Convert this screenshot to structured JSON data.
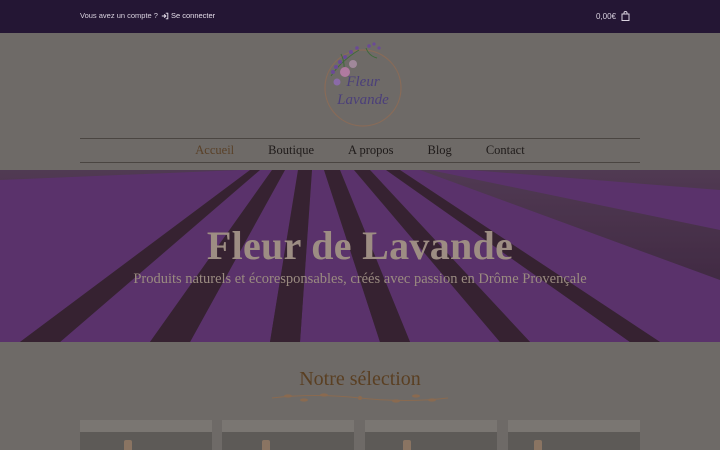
{
  "topbar": {
    "account_prompt": "Vous avez un compte ?",
    "login_label": "Se connecter",
    "cart_total": "0,00€"
  },
  "logo": {
    "line1": "Fleur",
    "line2": "Lavande"
  },
  "nav": {
    "items": [
      {
        "label": "Accueil",
        "active": true
      },
      {
        "label": "Boutique",
        "active": false
      },
      {
        "label": "A propos",
        "active": false
      },
      {
        "label": "Blog",
        "active": false
      },
      {
        "label": "Contact",
        "active": false
      }
    ]
  },
  "hero": {
    "title": "Fleur de Lavande",
    "subtitle": "Produits naturels et écoresponsables, créés avec passion en Drôme Provençale"
  },
  "selection": {
    "title": "Notre sélection"
  },
  "colors": {
    "topbar": "#241634",
    "page_overlay": "#6e6a67",
    "lavender": "#6a3a7a",
    "accent_brown": "#5a3f22"
  }
}
